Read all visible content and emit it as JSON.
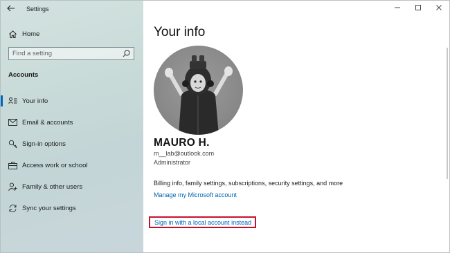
{
  "window": {
    "title": "Settings",
    "controls": {
      "minimize": "—",
      "maximize": "☐",
      "close": "✕"
    }
  },
  "sidebar": {
    "home_label": "Home",
    "search": {
      "placeholder": "Find a setting",
      "value": ""
    },
    "section_label": "Accounts",
    "items": [
      {
        "label": "Your info",
        "icon": "person-card-icon",
        "active": true
      },
      {
        "label": "Email & accounts",
        "icon": "envelope-icon",
        "active": false
      },
      {
        "label": "Sign-in options",
        "icon": "key-icon",
        "active": false
      },
      {
        "label": "Access work or school",
        "icon": "briefcase-icon",
        "active": false
      },
      {
        "label": "Family & other users",
        "icon": "person-add-icon",
        "active": false
      },
      {
        "label": "Sync your settings",
        "icon": "sync-icon",
        "active": false
      }
    ]
  },
  "main": {
    "page_title": "Your info",
    "user": {
      "name": "MAURO H.",
      "email": "m__lab@outlook.com",
      "role": "Administrator"
    },
    "billing_text": "Billing info, family settings, subscriptions, security settings, and more",
    "manage_link": "Manage my Microsoft account",
    "local_account_link": "Sign in with a local account instead"
  },
  "colors": {
    "accent": "#0067b8",
    "link": "#0063b1",
    "highlight_box": "#c8102e"
  }
}
